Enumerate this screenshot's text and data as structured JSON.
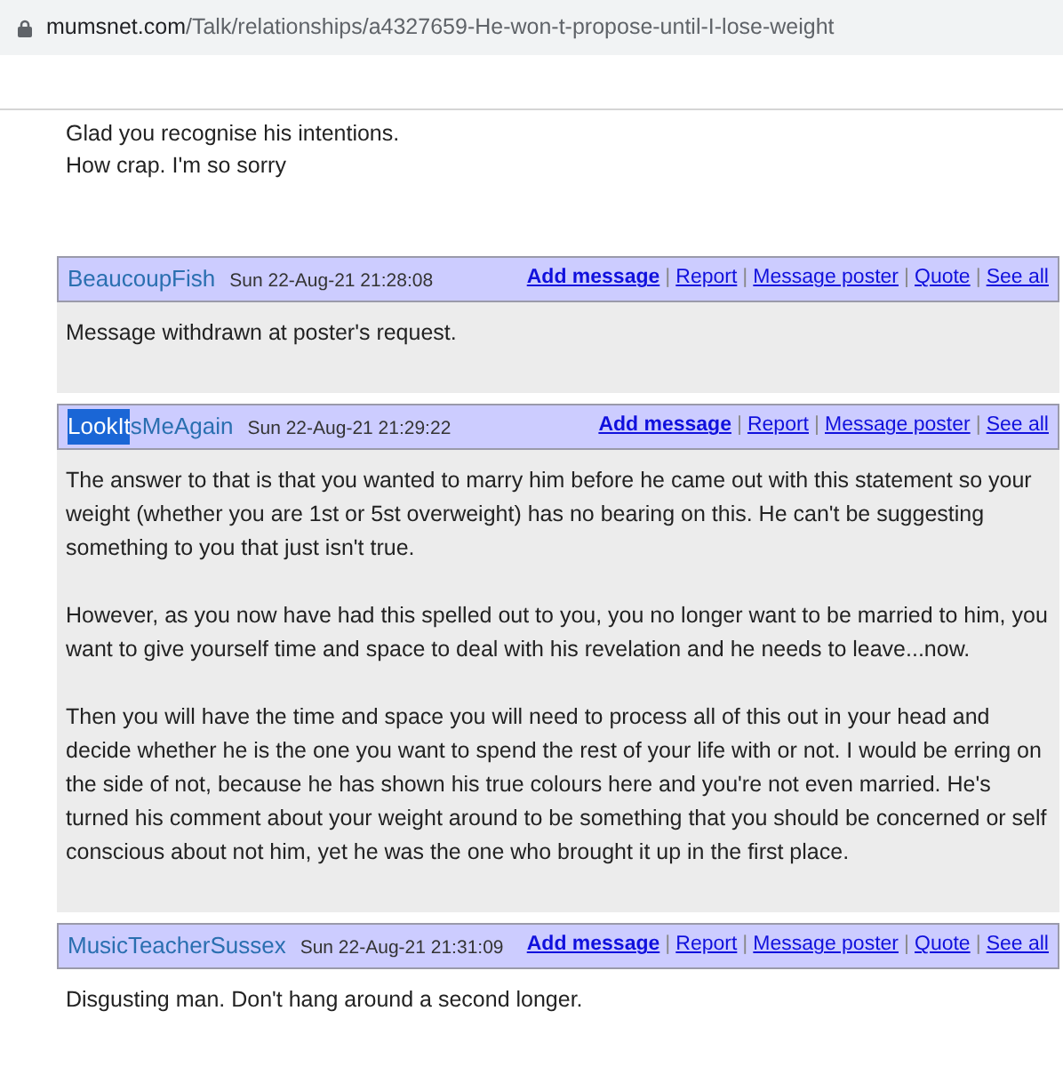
{
  "browser": {
    "url_domain": "mumsnet.com",
    "url_path": "/Talk/relationships/a4327659-He-won-t-propose-until-I-lose-weight"
  },
  "previous_message_tail": [
    "Glad you recognise his intentions.",
    "How crap. I'm so sorry"
  ],
  "posts": [
    {
      "username_parts": [
        {
          "text": "BeaucoupFish",
          "highlighted": false
        }
      ],
      "date": "Sun 22-Aug-21 21:28:08",
      "shaded": true,
      "links": [
        {
          "label": "Add message",
          "bold": true
        },
        {
          "separator": "|",
          "label": "Report",
          "bold": false
        },
        {
          "separator": "|",
          "label": "Message poster",
          "bold": false
        },
        {
          "separator": "|",
          "label": "Quote",
          "bold": false
        },
        {
          "separator": "|",
          "label": "See all",
          "bold": false
        }
      ],
      "paragraphs": [
        "Message withdrawn at poster's request."
      ]
    },
    {
      "username_parts": [
        {
          "text": "LookIt",
          "highlighted": true
        },
        {
          "text": "sMeAgain",
          "highlighted": false
        }
      ],
      "date": "Sun 22-Aug-21 21:29:22",
      "shaded": true,
      "links": [
        {
          "label": "Add message",
          "bold": true
        },
        {
          "separator": "|",
          "label": "Report",
          "bold": false
        },
        {
          "separator": "|",
          "label": "Message poster",
          "bold": false
        },
        {
          "separator": "|",
          "label": "See all",
          "bold": false
        }
      ],
      "paragraphs": [
        "The answer to that is that you wanted to marry him before he came out with this statement so your weight (whether you are 1st or 5st overweight) has no bearing on this. He can't be suggesting something to you that just isn't true.",
        "However, as you now have had this spelled out to you, you no longer want to be married to him, you want to give yourself time and space to deal with his revelation and he needs to leave...now.",
        "Then you will have the time and space you will need to process all of this out in your head and decide whether he is the one you want to spend the rest of your life with or not. I would be erring on the side of not, because he has shown his true colours here and you're not even married. He's turned his comment about your weight around to be something that you should be concerned or self conscious about not him, yet he was the one who brought it up in the first place."
      ]
    },
    {
      "username_parts": [
        {
          "text": "MusicTeacherSussex",
          "highlighted": false
        }
      ],
      "date": "Sun 22-Aug-21 21:31:09",
      "shaded": false,
      "links": [
        {
          "label": "Add message",
          "bold": true
        },
        {
          "separator": "|",
          "label": "Report",
          "bold": false
        },
        {
          "separator": "|",
          "label": "Message poster",
          "bold": false
        },
        {
          "separator": "|",
          "label": "Quote",
          "bold": false
        },
        {
          "separator": "|",
          "label": "See all",
          "bold": false
        }
      ],
      "paragraphs": [
        "Disgusting man. Don't hang around a second longer."
      ]
    }
  ]
}
